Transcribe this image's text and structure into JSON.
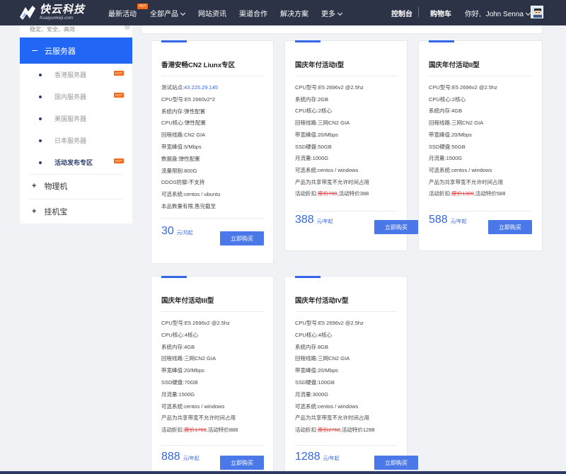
{
  "nav": {
    "logo_cn": "快云科技",
    "logo_en": "Kuaiyunkeji.com",
    "items": [
      {
        "label": "最新活动",
        "hot": "HOT"
      },
      {
        "label": "全部产品"
      },
      {
        "label": "网站资讯"
      },
      {
        "label": "渠道合作"
      },
      {
        "label": "解决方案"
      },
      {
        "label": "更多"
      }
    ],
    "console": "控制台",
    "cart": "购物车",
    "greeting": "你好,",
    "user": "John Senna"
  },
  "sidebar": {
    "top_text": "稳定、安全、高效",
    "active": "云服务器",
    "sub_items": [
      {
        "label": "香港服务器",
        "hot": "HOT"
      },
      {
        "label": "国内服务器",
        "hot": "HOT"
      },
      {
        "label": "美国服务器",
        "hot": ""
      },
      {
        "label": "日本服务器",
        "hot": ""
      },
      {
        "label": "活动发布专区",
        "hot": "HOT"
      }
    ],
    "groups": [
      {
        "label": "物理机"
      },
      {
        "label": "挂机宝"
      }
    ]
  },
  "cards": [
    {
      "title": "香港安畅CN2 Liunx专区",
      "specs": [
        {
          "k": "测试站点:",
          "v": "43.225.29.145",
          "type": "ip"
        },
        {
          "k": "CPU型号:",
          "v": "E5 2660v2*2"
        },
        {
          "k": "系统内存:",
          "v": "弹性配置"
        },
        {
          "k": "CPU核心:",
          "v": "弹性配置"
        },
        {
          "k": "回程线路:",
          "v": "CN2 GIA"
        },
        {
          "k": "带宽峰值:",
          "v": "5/Mbps"
        },
        {
          "k": "数据盘:",
          "v": "弹性配置"
        },
        {
          "k": "流量限制:",
          "v": "800G"
        },
        {
          "k": "DDOS防御:",
          "v": "不支持"
        },
        {
          "k": "可选系统:",
          "v": "centos / ubuntu"
        },
        {
          "k": "本品数量有限,",
          "v": "售完截至"
        }
      ],
      "price": "30",
      "unit": "元/月起",
      "buy": "立即购买"
    },
    {
      "title": "国庆年付活动I型",
      "specs": [
        {
          "k": "CPU型号:",
          "v": "E5 2696v2 @2.5hz"
        },
        {
          "k": "系统内存:",
          "v": "2GB"
        },
        {
          "k": "CPU核心:",
          "v": "2核心"
        },
        {
          "k": "回程线路:",
          "v": "三网CN2 GIA"
        },
        {
          "k": "带宽峰值:",
          "v": "20/Mbps"
        },
        {
          "k": "SSD硬盘:",
          "v": "50GB"
        },
        {
          "k": "月流量:",
          "v": "1000G"
        },
        {
          "k": "可选系统:",
          "v": "centos / windows"
        },
        {
          "k": "产品为共享带宽不允许时间占用",
          "v": ""
        },
        {
          "k": "活动折扣:",
          "strike": "原价788",
          "v": ",活动特价388"
        }
      ],
      "price": "388",
      "unit": "元/年起",
      "buy": "立即购买"
    },
    {
      "title": "国庆年付活动II型",
      "specs": [
        {
          "k": "CPU型号:",
          "v": "E5 2696v2 @2.5hz"
        },
        {
          "k": "CPU核心:",
          "v": "2核心"
        },
        {
          "k": "系统内存:",
          "v": "4GB"
        },
        {
          "k": "回程线路:",
          "v": "三网CN2 GIA"
        },
        {
          "k": "带宽峰值:",
          "v": "20/Mbps"
        },
        {
          "k": "SSD硬盘:",
          "v": "50GB"
        },
        {
          "k": "月流量:",
          "v": "1500G"
        },
        {
          "k": "可选系统:",
          "v": "centos / windows"
        },
        {
          "k": "产品为共享带宽不允许时间占用",
          "v": ""
        },
        {
          "k": "活动折扣:",
          "strike": "原价1320",
          "v": ",活动特价588"
        }
      ],
      "price": "588",
      "unit": "元/年起",
      "buy": "立即购买"
    },
    {
      "title": "国庆年付活动III型",
      "specs": [
        {
          "k": "CPU型号:",
          "v": "E5 2696v2 @2.5hz"
        },
        {
          "k": "CPU核心:",
          "v": "4核心"
        },
        {
          "k": "系统内存:",
          "v": "4GB"
        },
        {
          "k": "回程线路:",
          "v": "三网CN2 GIA"
        },
        {
          "k": "带宽峰值:",
          "v": "20/Mbps"
        },
        {
          "k": "SSD硬盘:",
          "v": "70GB"
        },
        {
          "k": "月流量:",
          "v": "1500G"
        },
        {
          "k": "可选系统:",
          "v": "centos / windows"
        },
        {
          "k": "产品为共享带宽不允许时间占用",
          "v": ""
        },
        {
          "k": "活动折扣:",
          "strike": "原价1760",
          "v": ",活动特价888"
        }
      ],
      "price": "888",
      "unit": "元/年起",
      "buy": "立即购买"
    },
    {
      "title": "国庆年付活动IV型",
      "specs": [
        {
          "k": "CPU型号:",
          "v": "E5 2696v2 @2.5hz"
        },
        {
          "k": "CPU核心:",
          "v": "4核心"
        },
        {
          "k": "系统内存:",
          "v": "8GB"
        },
        {
          "k": "回程线路:",
          "v": "三网CN2 GIA"
        },
        {
          "k": "带宽峰值:",
          "v": "20/Mbps"
        },
        {
          "k": "SSD硬盘:",
          "v": "100GB"
        },
        {
          "k": "月流量:",
          "v": "3000G"
        },
        {
          "k": "可选系统:",
          "v": "centos / windows"
        },
        {
          "k": "产品为共享带宽不允许时间占用",
          "v": ""
        },
        {
          "k": "活动折扣:",
          "strike": "原价2760",
          "v": ",活动特价1288"
        }
      ],
      "price": "1288",
      "unit": "元/年起",
      "buy": "立即购买"
    }
  ]
}
